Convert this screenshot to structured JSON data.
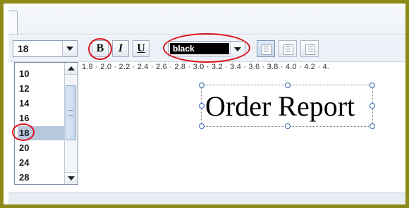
{
  "toolbar": {
    "font_size_value": "18",
    "bold_label": "B",
    "italic_label": "I",
    "underline_label": "U",
    "color_value": "black"
  },
  "font_size_options": [
    "10",
    "12",
    "14",
    "16",
    "18",
    "20",
    "24",
    "28"
  ],
  "selected_font_size": "18",
  "ruler_text": "1.8 · 2.0 · 2.2 · 2.4 · 2.6 · 2.8 · 3.0 · 3.2 · 3.4 · 3.6 · 3.8 · 4.0 · 4.2 · 4.",
  "canvas": {
    "text_box_content": "Order Report"
  },
  "colors": {
    "frame_border": "#8b8a16",
    "annotation": "#d9141b",
    "selection": "#b7c7dd",
    "color_swatch": "#000000"
  },
  "icons": [
    "align-left-icon",
    "align-center-icon",
    "align-right-icon",
    "dropdown-arrow-icon",
    "scroll-up-icon",
    "scroll-down-icon"
  ]
}
